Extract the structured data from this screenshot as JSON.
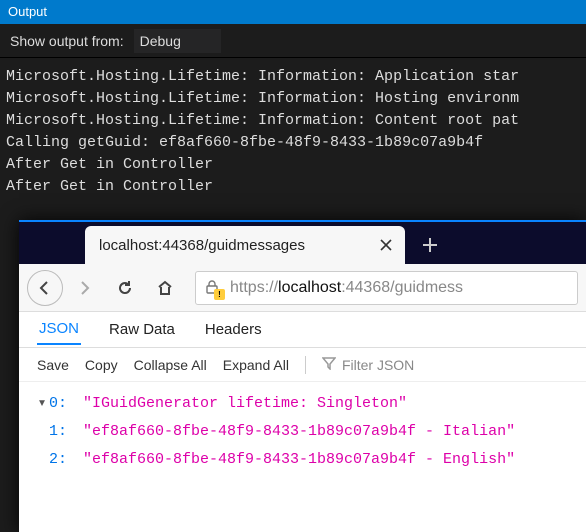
{
  "output_panel": {
    "title": "Output",
    "show_from_label": "Show output from:",
    "source_selected": "Debug"
  },
  "console_lines": [
    "Microsoft.Hosting.Lifetime: Information: Application star",
    "Microsoft.Hosting.Lifetime: Information: Hosting environm",
    "Microsoft.Hosting.Lifetime: Information: Content root pat",
    "Calling getGuid: ef8af660-8fbe-48f9-8433-1b89c07a9b4f",
    "After Get in Controller",
    "After Get in Controller"
  ],
  "browser": {
    "tab": {
      "label": "localhost:44368/guidmessages"
    },
    "url": {
      "scheme": "https://",
      "host": "localhost",
      "rest": ":44368/guidmess"
    },
    "subtabs": {
      "json": "JSON",
      "raw": "Raw Data",
      "headers": "Headers"
    },
    "actions": {
      "save": "Save",
      "copy": "Copy",
      "collapse": "Collapse All",
      "expand": "Expand All",
      "filter_placeholder": "Filter JSON"
    },
    "json_rows": [
      {
        "key": "0:",
        "value": "\"IGuidGenerator lifetime: Singleton\""
      },
      {
        "key": "1:",
        "value": "\"ef8af660-8fbe-48f9-8433-1b89c07a9b4f - Italian\""
      },
      {
        "key": "2:",
        "value": "\"ef8af660-8fbe-48f9-8433-1b89c07a9b4f - English\""
      }
    ]
  }
}
